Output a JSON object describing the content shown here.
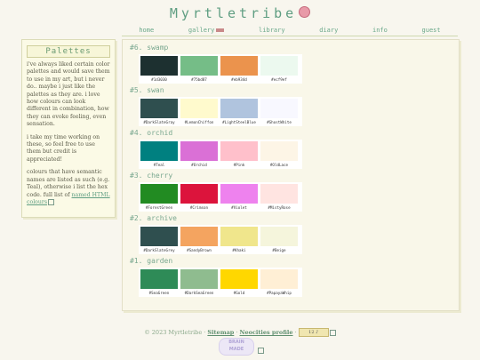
{
  "site": {
    "title": "Myrtletribe"
  },
  "nav": {
    "items": [
      "home",
      "gallery",
      "library",
      "diary",
      "info",
      "guest"
    ]
  },
  "sidebar": {
    "heading": "Palettes",
    "para1": "i've always liked certain color palettes and would save them to use in my art, but i never do.. maybe i just like the palettes as they are. i love how colours can look different in combination, how they can evoke feeling, even sensation.",
    "para2": "i take my time working on these, so feel free to use them but credit is appreciated!",
    "para3_pre": "colours that have semantic names are listed as such (e.g. Teal), otherwise i list the hex code. full list of ",
    "para3_link": "named HTML colours"
  },
  "palettes": [
    {
      "title": "#6. swamp",
      "colors": [
        {
          "name": "#1d3030",
          "hex": "#1d3030"
        },
        {
          "name": "#75bd87",
          "hex": "#75bd87"
        },
        {
          "name": "#eb934d",
          "hex": "#eb934d"
        },
        {
          "name": "#ecf9ef",
          "hex": "#ecf9ef"
        }
      ]
    },
    {
      "title": "#5. swan",
      "colors": [
        {
          "name": "#DarkSlateGray",
          "hex": "#2f4f4f"
        },
        {
          "name": "#LemonChiffon",
          "hex": "#fffacd"
        },
        {
          "name": "#LightSteelBlue",
          "hex": "#b0c4de"
        },
        {
          "name": "#GhostWhite",
          "hex": "#f8f8ff"
        }
      ]
    },
    {
      "title": "#4. orchid",
      "colors": [
        {
          "name": "#Teal",
          "hex": "#008080"
        },
        {
          "name": "#Orchid",
          "hex": "#da70d6"
        },
        {
          "name": "#Pink",
          "hex": "#ffc0cb"
        },
        {
          "name": "#OldLace",
          "hex": "#fdf5e6"
        }
      ]
    },
    {
      "title": "#3. cherry",
      "colors": [
        {
          "name": "#ForestGreen",
          "hex": "#228b22"
        },
        {
          "name": "#Crimson",
          "hex": "#dc143c"
        },
        {
          "name": "#Violet",
          "hex": "#ee82ee"
        },
        {
          "name": "#MistyRose",
          "hex": "#ffe4e1"
        }
      ]
    },
    {
      "title": "#2. archive",
      "colors": [
        {
          "name": "#DarkSlateGrey",
          "hex": "#2f4f4f"
        },
        {
          "name": "#SandyBrown",
          "hex": "#f4a460"
        },
        {
          "name": "#Khaki",
          "hex": "#f0e68c"
        },
        {
          "name": "#Beige",
          "hex": "#f5f5dc"
        }
      ]
    },
    {
      "title": "#1. garden",
      "colors": [
        {
          "name": "#SeaGreen",
          "hex": "#2e8b57"
        },
        {
          "name": "#DarkSeaGreen",
          "hex": "#8fbc8f"
        },
        {
          "name": "#Gold",
          "hex": "#ffd700"
        },
        {
          "name": "#PapayaWhip",
          "hex": "#ffefd5"
        }
      ]
    }
  ],
  "footer": {
    "copyright": "© 2023 Myrtletribe",
    "sitemap": "Sitemap",
    "neocities": "Neocities profile",
    "badge": "12 ♪"
  }
}
